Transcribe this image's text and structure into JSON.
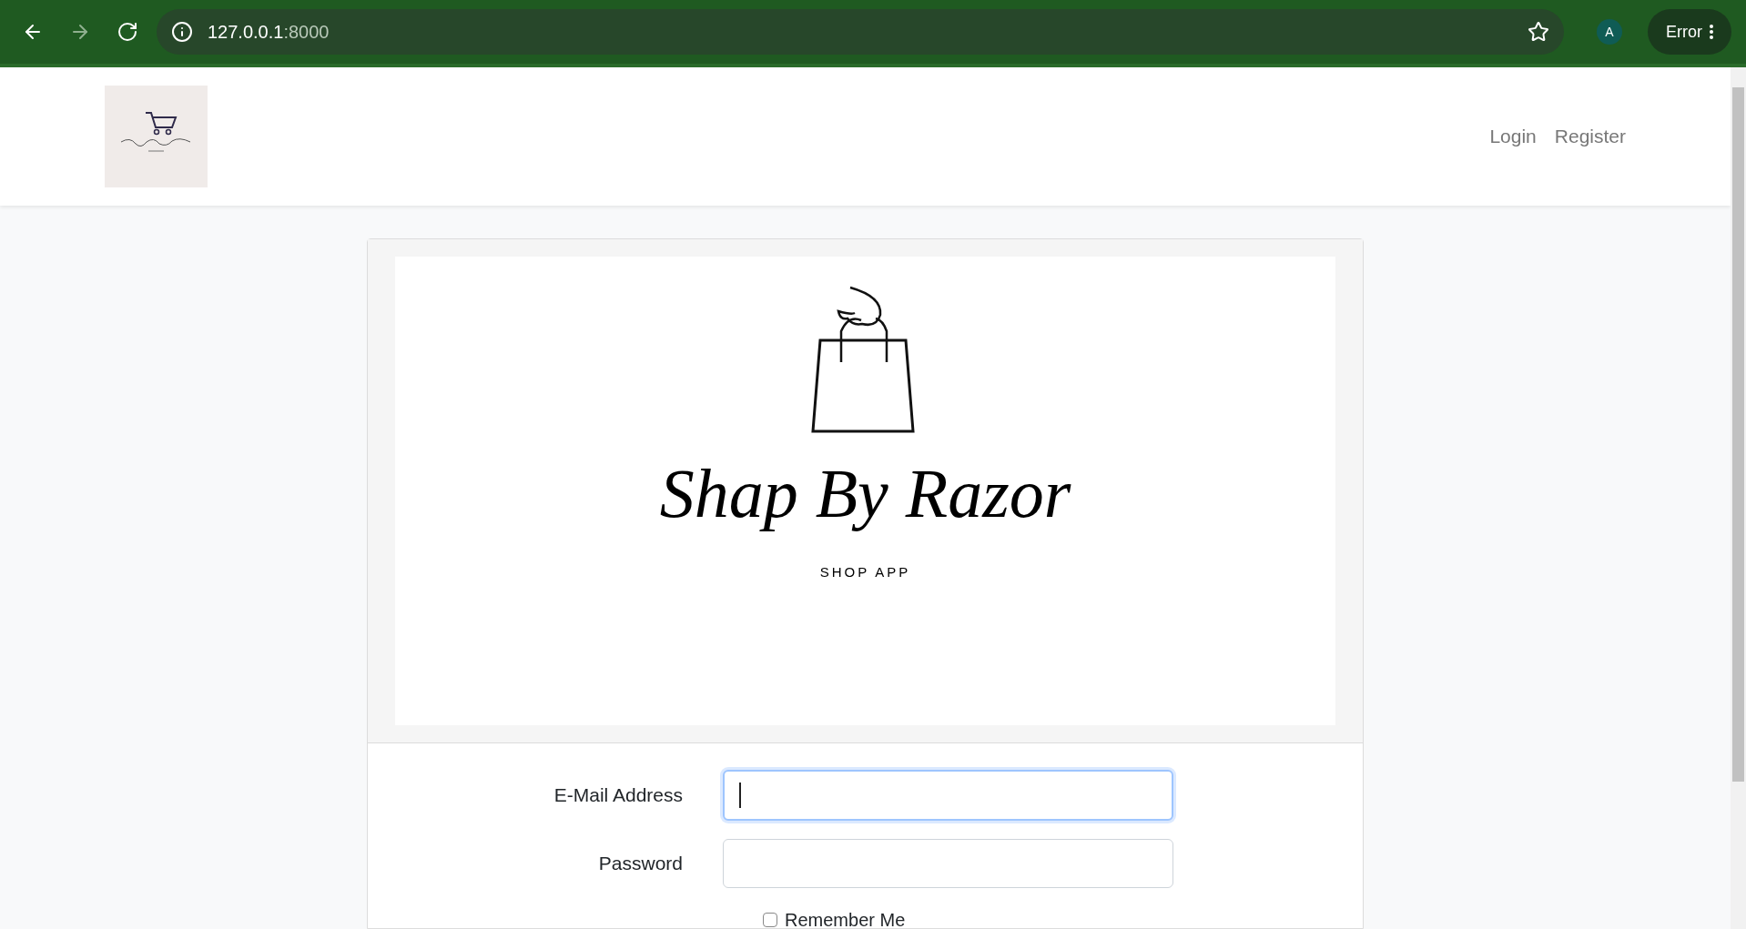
{
  "browser": {
    "url_host": "127.0.0.1",
    "url_port": ":8000",
    "profile_initial": "A",
    "error_label": "Error"
  },
  "navbar": {
    "links": [
      {
        "label": "Login"
      },
      {
        "label": "Register"
      }
    ]
  },
  "brand": {
    "title": "Shap By Razor",
    "subtitle": "SHOP APP"
  },
  "form": {
    "fields": [
      {
        "label": "E-Mail Address",
        "focused": true
      },
      {
        "label": "Password",
        "focused": false
      }
    ],
    "remember": {
      "label": "Remember Me",
      "checked": false
    }
  }
}
